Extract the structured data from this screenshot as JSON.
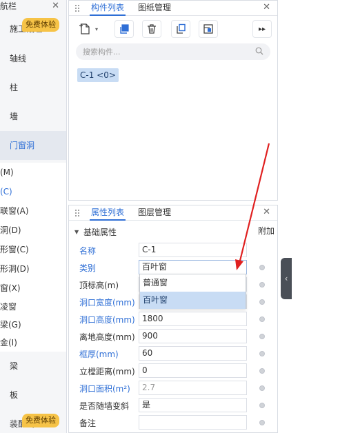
{
  "nav": {
    "title": "航栏",
    "items": [
      {
        "label": "施工段",
        "badge": "免费体验"
      },
      {
        "label": "轴线"
      },
      {
        "label": "柱"
      },
      {
        "label": "墙"
      },
      {
        "label": "门窗洞"
      }
    ],
    "subitems": [
      "(M)",
      "(C)",
      "联窗(A)",
      "洞(D)",
      "形窗(C)",
      "形洞(D)",
      "窗(X)",
      "凌窗",
      "梁(G)",
      "金(I)"
    ],
    "bottom_items": [
      {
        "label": "梁"
      },
      {
        "label": "板"
      },
      {
        "label": "装配式",
        "badge": "免费体验"
      }
    ]
  },
  "top_panel": {
    "tabs": [
      "构件列表",
      "图纸管理"
    ],
    "search_placeholder": "搜索构件...",
    "component": "C-1 <0>",
    "toolbar_icons": [
      "new-component-icon",
      "copy-icon",
      "delete-icon",
      "duplicate-icon",
      "layer-icon",
      "more-icon"
    ]
  },
  "bottom_panel": {
    "tabs": [
      "属性列表",
      "图层管理"
    ],
    "section": "基础属性",
    "extra_col": "附加",
    "props": [
      {
        "label": "名称",
        "value": "C-1",
        "blue": true
      },
      {
        "label": "类别",
        "value": "百叶窗",
        "blue": true
      },
      {
        "label": "顶标高(m)",
        "value": "",
        "blue": false
      },
      {
        "label": "洞口宽度(mm)",
        "value": "",
        "blue": true
      },
      {
        "label": "洞口高度(mm)",
        "value": "1800",
        "blue": true
      },
      {
        "label": "离地高度(mm)",
        "value": "900",
        "blue": false
      },
      {
        "label": "框厚(mm)",
        "value": "60",
        "blue": true
      },
      {
        "label": "立樘距离(mm)",
        "value": "0",
        "blue": false
      },
      {
        "label": "洞口面积(m²)",
        "value": "2.7",
        "blue": true
      },
      {
        "label": "是否随墙变斜",
        "value": "是",
        "blue": false
      },
      {
        "label": "备注",
        "value": "",
        "blue": false
      }
    ],
    "dropdown_options": [
      "普通窗",
      "百叶窗"
    ],
    "dropdown_selected": "百叶窗"
  },
  "colors": {
    "accent": "#2f6fd6",
    "badge": "#f6c347",
    "arrow": "#e02020"
  }
}
